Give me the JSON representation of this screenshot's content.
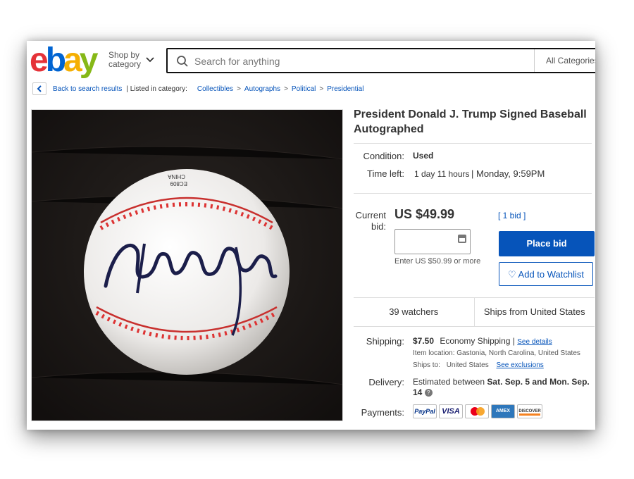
{
  "header": {
    "logo_letters": [
      "e",
      "b",
      "a",
      "y"
    ],
    "logo_colors": [
      "#e53238",
      "#0064d2",
      "#f5af02",
      "#86b817"
    ],
    "shop_by_line1": "Shop by",
    "shop_by_line2": "category",
    "search_placeholder": "Search for anything",
    "category_select": "All Categories"
  },
  "breadcrumb": {
    "back_label": "Back to search results",
    "listed_in": "| Listed in category:",
    "items": [
      "Collectibles",
      "Autographs",
      "Political",
      "Presidential"
    ]
  },
  "listing": {
    "title": "President Donald J. Trump Signed Baseball Autographed",
    "condition_label": "Condition:",
    "condition_value": "Used",
    "time_left_label": "Time left:",
    "time_left_value": "1 day 11 hours",
    "time_left_end": "| Monday, 9:59PM",
    "current_bid_label_line1": "Current",
    "current_bid_label_line2": "bid:",
    "current_bid_value": "US $49.99",
    "bids_count": "[ 1 bid ]",
    "bid_hint": "Enter US $50.99 or more",
    "place_bid": "Place bid",
    "add_watchlist": "Add to Watchlist",
    "watchers": "39 watchers",
    "ships_from": "Ships from United States",
    "shipping_label": "Shipping:",
    "shipping_cost": "$7.50",
    "shipping_method": "Economy Shipping",
    "shipping_sep": "|",
    "see_details": "See details",
    "item_location": "Item location:  Gastonia, North Carolina, United States",
    "ships_to_label": "Ships to:",
    "ships_to_value": "United States",
    "see_exclusions": "See exclusions",
    "delivery_label": "Delivery:",
    "delivery_prefix": "Estimated between",
    "delivery_dates": "Sat. Sep. 5 and Mon. Sep. 14",
    "payments_label": "Payments:",
    "payment_methods": [
      "PayPal",
      "VISA",
      "MC",
      "AMEX",
      "DISCOVER"
    ]
  },
  "photo": {
    "ball_stamp_line1": "CHINA",
    "ball_stamp_line2": "EC809"
  }
}
